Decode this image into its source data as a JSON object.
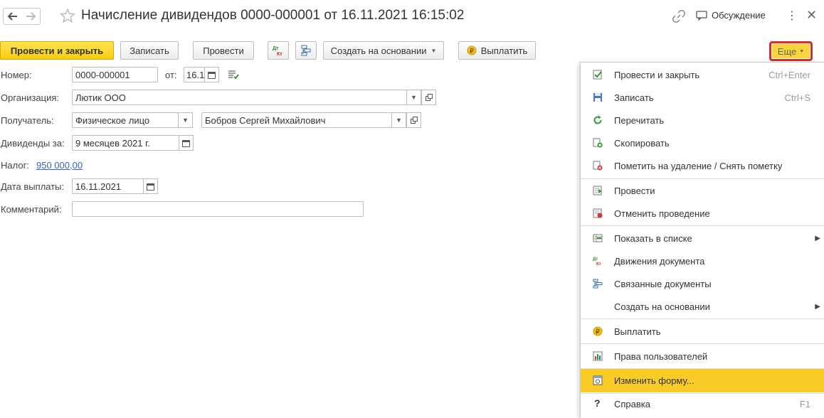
{
  "window": {
    "title": "Начисление дивидендов 0000-000001 от 16.11.2021 16:15:02",
    "discussion_label": "Обсуждение"
  },
  "toolbar": {
    "post_and_close": "Провести и закрыть",
    "save": "Записать",
    "post": "Провести",
    "create_based_on": "Создать на основании",
    "pay": "Выплатить",
    "more": "Еще"
  },
  "form": {
    "number_label": "Номер:",
    "number_value": "0000-000001",
    "date_label": "от:",
    "date_value": "16.1",
    "org_label": "Организация:",
    "org_value": "Лютик ООО",
    "recipient_label": "Получатель:",
    "recipient_type": "Физическое лицо",
    "recipient_name": "Бобров Сергей Михайлович",
    "dividends_for_label": "Дивиденды за:",
    "dividends_for_value": "9 месяцев 2021 г.",
    "tax_label": "Налог:",
    "tax_value": "950 000,00",
    "pay_date_label": "Дата выплаты:",
    "pay_date_value": "16.11.2021",
    "comment_label": "Комментарий:",
    "comment_value": ""
  },
  "menu": {
    "items": [
      {
        "label": "Провести и закрыть",
        "shortcut": "Ctrl+Enter",
        "icon": "post-close-icon"
      },
      {
        "label": "Записать",
        "shortcut": "Ctrl+S",
        "icon": "save-icon"
      },
      {
        "label": "Перечитать",
        "shortcut": "",
        "icon": "reload-icon"
      },
      {
        "label": "Скопировать",
        "shortcut": "",
        "icon": "copy-icon"
      },
      {
        "label": "Пометить на удаление / Снять пометку",
        "shortcut": "",
        "icon": "mark-delete-icon"
      },
      {
        "label": "Провести",
        "shortcut": "",
        "icon": "post-icon"
      },
      {
        "label": "Отменить проведение",
        "shortcut": "",
        "icon": "unpost-icon"
      },
      {
        "label": "Показать в списке",
        "shortcut": "",
        "icon": "show-in-list-icon"
      },
      {
        "label": "Движения документа",
        "shortcut": "",
        "icon": "document-movements-icon"
      },
      {
        "label": "Связанные документы",
        "shortcut": "",
        "icon": "related-documents-icon"
      },
      {
        "label": "Создать на основании",
        "shortcut": "",
        "icon": "none"
      },
      {
        "label": "Выплатить",
        "shortcut": "",
        "icon": "pay-coin-icon"
      },
      {
        "label": "Права пользователей",
        "shortcut": "",
        "icon": "user-rights-icon"
      },
      {
        "label": "Изменить форму...",
        "shortcut": "",
        "icon": "change-form-icon"
      },
      {
        "label": "Справка",
        "shortcut": "F1",
        "icon": "help-icon"
      }
    ],
    "help_glyph": "?"
  },
  "colors": {
    "primary_button": "#f5cc12",
    "menu_highlight": "#f9cc27",
    "more_outline": "#e02a2a",
    "link": "#3866b4"
  }
}
